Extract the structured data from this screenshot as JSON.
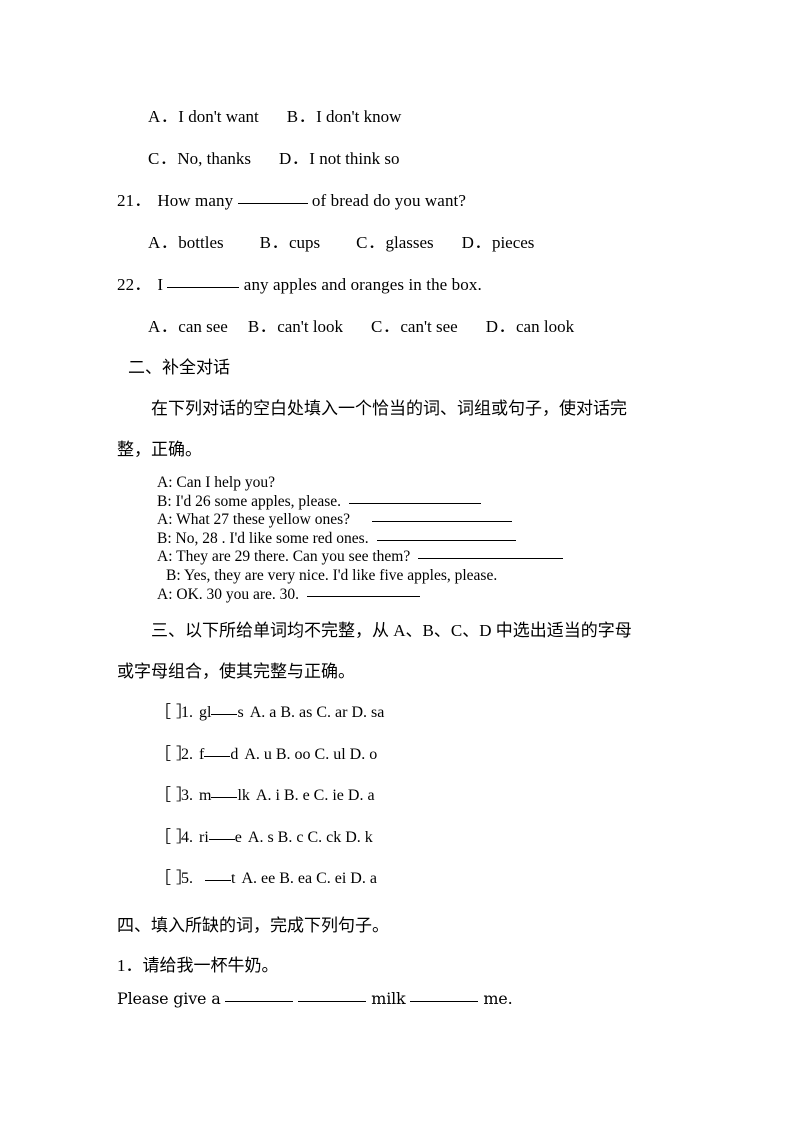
{
  "document": {
    "type": "english-exam-worksheet"
  },
  "q20_options": {
    "row1": [
      {
        "label": "A．",
        "text": "I don't want"
      },
      {
        "label": "B．",
        "text": "I don't know"
      }
    ],
    "row2": [
      {
        "label": "C．",
        "text": "No, thanks"
      },
      {
        "label": "D．",
        "text": "I not think so"
      }
    ]
  },
  "q21": {
    "number": "21．",
    "stem_before": "How many",
    "stem_after": "of bread do you want?",
    "options": [
      {
        "label": "A．",
        "text": "bottles"
      },
      {
        "label": "B．",
        "text": "cups"
      },
      {
        "label": "C．",
        "text": "glasses"
      },
      {
        "label": "D．",
        "text": "pieces"
      }
    ]
  },
  "q22": {
    "number": "22．",
    "stem_before": "I",
    "stem_after": "any apples and oranges in the box.",
    "options": [
      {
        "label": "A．",
        "text": "can see"
      },
      {
        "label": "B．",
        "text": "can't look"
      },
      {
        "label": "C．",
        "text": "can't see"
      },
      {
        "label": "D．",
        "text": "can look"
      }
    ]
  },
  "section2": {
    "heading": "二、补全对话",
    "instruction_line1": "在下列对话的空白处填入一个恰当的词、词组或句子，使对话完",
    "instruction_line2": "整，正确。",
    "dialogue": [
      {
        "text": "A: Can I help you?",
        "blank": false
      },
      {
        "text": "B: I'd 26 some apples, please.",
        "blank": true
      },
      {
        "text": "A: What 27 these yellow ones?",
        "blank": true
      },
      {
        "text": "B: No, 28 . I'd like some red ones.",
        "blank": true
      },
      {
        "text": "A: They are 29 there. Can you see them?",
        "blank": true
      },
      {
        "text": "B: Yes, they are very nice. I'd like five apples, please.",
        "blank": false
      },
      {
        "text": "A: OK. 30 you are. 30.",
        "blank": true
      }
    ]
  },
  "section3": {
    "heading_line1": "三、以下所给单词均不完整，从 A、B、C、D 中选出适当的字母",
    "heading_line2": "或字母组合，使其完整与正确。",
    "items": [
      {
        "bracket": "［ ］",
        "number": "1.",
        "word_before": "gl",
        "word_after": "s",
        "choices": "A. a B. as C. ar D. sa"
      },
      {
        "bracket": "［ ］",
        "number": "2.",
        "word_before": "f",
        "word_after": "d",
        "choices": "A. u B. oo C. ul D. o"
      },
      {
        "bracket": "［ ］",
        "number": "3.",
        "word_before": "m",
        "word_after": "lk",
        "choices": "A. i B. e C. ie D. a"
      },
      {
        "bracket": "［ ］",
        "number": "4.",
        "word_before": "ri",
        "word_after": "e",
        "choices": "A. s B. c C. ck D. k"
      },
      {
        "bracket": "［ ］",
        "number": "5.",
        "word_before": "",
        "word_after": "t",
        "choices": "A. ee B. ea C. ei D. a"
      }
    ]
  },
  "section4": {
    "heading": "四、填入所缺的词，完成下列句子。",
    "item1_number": "1．",
    "item1_chinese": "请给我一杯牛奶。",
    "item1_english": {
      "part1": "Please give a",
      "part2": "",
      "part3": "milk",
      "part4": "me."
    }
  }
}
